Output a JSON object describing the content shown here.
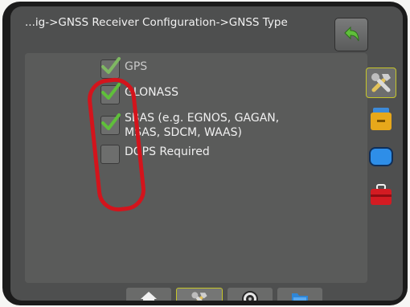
{
  "header": {
    "breadcrumb": "...ig->GNSS Receiver Configuration->GNSS Type"
  },
  "options": [
    {
      "label": "GPS",
      "checked": true,
      "disabled": true
    },
    {
      "label": "GLONASS",
      "checked": true,
      "disabled": false
    },
    {
      "label_line1": "SBAS (e.g. EGNOS, GAGAN,",
      "label_line2": "MSAS, SDCM, WAAS)",
      "checked": true,
      "disabled": false
    },
    {
      "label": "DGPS Required",
      "checked": false,
      "disabled": false
    }
  ],
  "side_nav": [
    "tools-icon",
    "console-icon",
    "display-icon",
    "toolbox-icon"
  ],
  "bottom_tabs": [
    "home-icon",
    "tools-icon",
    "guidance-icon",
    "data-icon"
  ],
  "colors": {
    "accent": "#c6c62a",
    "check": "#5fbf3a",
    "highlight": "#d3141c"
  }
}
